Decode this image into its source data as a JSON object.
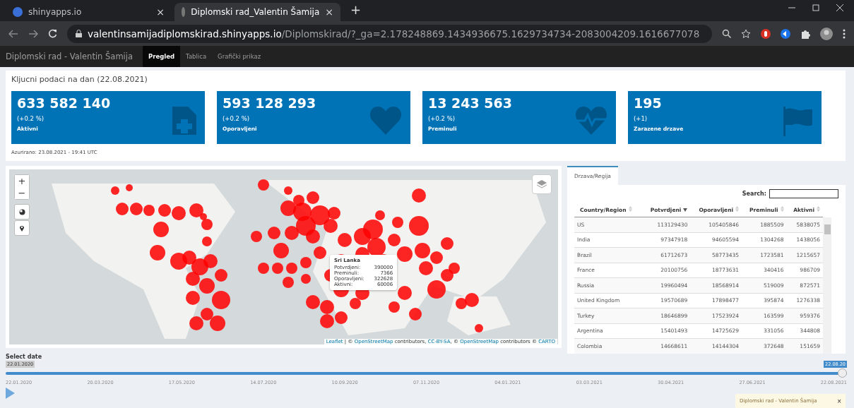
{
  "browser": {
    "tabs": [
      {
        "title": "shinyapps.io",
        "close": "×",
        "selected": false
      },
      {
        "title": "Diplomski rad_Valentin Šamija",
        "close": "×",
        "selected": true
      }
    ],
    "new_tab": "+",
    "url_host": "valentinsamijadiplomskirad.shinyapps.io",
    "url_path": "/Diplomskirad/?_ga=2.178248869.1434936675.1629734734-2083004209.1616677078"
  },
  "app": {
    "brand": "Diplomski rad - Valentin Šamija",
    "nav": [
      {
        "label": "Pregled",
        "selected": true
      },
      {
        "label": "Tablica",
        "selected": false
      },
      {
        "label": "Grafički prikaz",
        "selected": false
      }
    ]
  },
  "key_figures": {
    "title": "Kljucni podaci na dan (22.08.2021)",
    "boxes": [
      {
        "value": "633 582 140",
        "change": "(+0.2 %)",
        "label": "Aktivni",
        "kind": "file-plus"
      },
      {
        "value": "593 128 293",
        "change": "(+0.2 %)",
        "label": "Oporavljeni",
        "kind": "heart"
      },
      {
        "value": "13 243 563",
        "change": "(+0.2 %)",
        "label": "Preminuli",
        "kind": "heartbeat"
      },
      {
        "value": "195",
        "change": "(+1)",
        "label": "Zarazene drzave",
        "kind": "flag"
      }
    ],
    "updated": "Azurirano: 23.08.2021 - 19:41 UTC"
  },
  "map": {
    "zoom_in": "+",
    "zoom_out": "−",
    "tooltip": {
      "title": "Sri Lanka",
      "rows": [
        {
          "label": "Potvrdjeni:",
          "value": "390000"
        },
        {
          "label": "Preminuli:",
          "value": "7366"
        },
        {
          "label": "Oporavljeni:",
          "value": "322628"
        },
        {
          "label": "Aktivni:",
          "value": "60006"
        }
      ]
    },
    "attribution": [
      {
        "text": "Leaflet",
        "link": true
      },
      {
        "text": " | © ",
        "link": false
      },
      {
        "text": "OpenStreetMap",
        "link": true
      },
      {
        "text": " contributors, ",
        "link": false
      },
      {
        "text": "CC-BY-SA",
        "link": true
      },
      {
        "text": ", © ",
        "link": false
      },
      {
        "text": "OpenStreetMap",
        "link": true
      },
      {
        "text": " contributors © ",
        "link": false
      },
      {
        "text": "CARTO",
        "link": true
      }
    ]
  },
  "table": {
    "tab": "Drzava/Regija",
    "search_label": "Search:",
    "columns": [
      {
        "label": "Country/Region",
        "sorted": false
      },
      {
        "label": "Potvrdjeni",
        "sorted": true
      },
      {
        "label": "Oporavljeni",
        "sorted": false
      },
      {
        "label": "Preminuli",
        "sorted": false
      },
      {
        "label": "Aktivni",
        "sorted": false
      }
    ],
    "rows": [
      [
        "US",
        "113129430",
        "105405846",
        "1885509",
        "5838075"
      ],
      [
        "India",
        "97347918",
        "94605594",
        "1304268",
        "1438056"
      ],
      [
        "Brazil",
        "61712673",
        "58773435",
        "1723581",
        "1215657"
      ],
      [
        "France",
        "20100756",
        "18773631",
        "340416",
        "986709"
      ],
      [
        "Russia",
        "19960494",
        "18568914",
        "519009",
        "872571"
      ],
      [
        "United Kingdom",
        "19570689",
        "17898477",
        "395874",
        "1276338"
      ],
      [
        "Turkey",
        "18646899",
        "17523924",
        "163599",
        "959376"
      ],
      [
        "Argentina",
        "15401493",
        "14725629",
        "331056",
        "344808"
      ],
      [
        "Colombia",
        "14668611",
        "14144304",
        "372648",
        "151659"
      ]
    ]
  },
  "slider": {
    "label": "Select date",
    "min_label": "22.01.2020",
    "value_label": "22.08.20",
    "level": 1,
    "ticks": [
      "22.01.2020",
      "20.03.2020",
      "17.05.2020",
      "14.07.2020",
      "10.09.2020",
      "07.11.2020",
      "04.01.2021",
      "03.03.2021",
      "30.04.2021",
      "27.06.2021",
      "22.08.2021"
    ]
  },
  "toast": {
    "text": "Diplomski rad - Valentin Šamija",
    "close": "×"
  }
}
